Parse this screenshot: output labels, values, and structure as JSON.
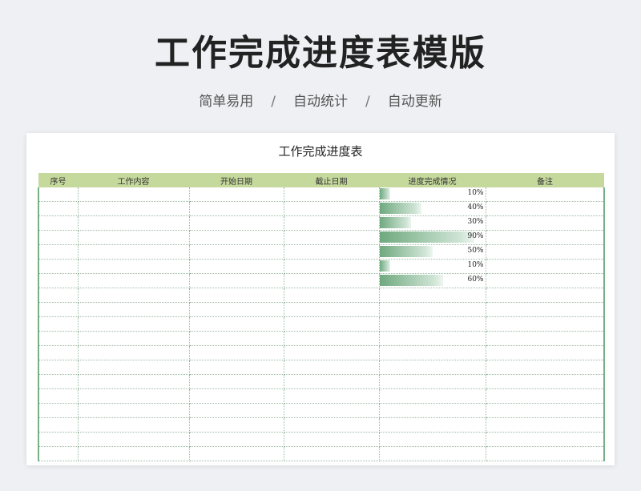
{
  "title": "工作完成进度表模版",
  "features": [
    "简单易用",
    "自动统计",
    "自动更新"
  ],
  "separator": "/",
  "sheet": {
    "title": "工作完成进度表",
    "headers": [
      "序号",
      "工作内容",
      "开始日期",
      "截止日期",
      "进度完成情况",
      "备注"
    ],
    "progress_values": [
      0.1,
      0.4,
      0.3,
      0.9,
      0.5,
      0.1,
      0.6
    ],
    "progress_labels": [
      "10%",
      "40%",
      "30%",
      "90%",
      "50%",
      "10%",
      "60%"
    ],
    "colors": {
      "header_bg": "#c6d99c",
      "bar_start": "#6fa97f",
      "border": "#76b087"
    }
  }
}
